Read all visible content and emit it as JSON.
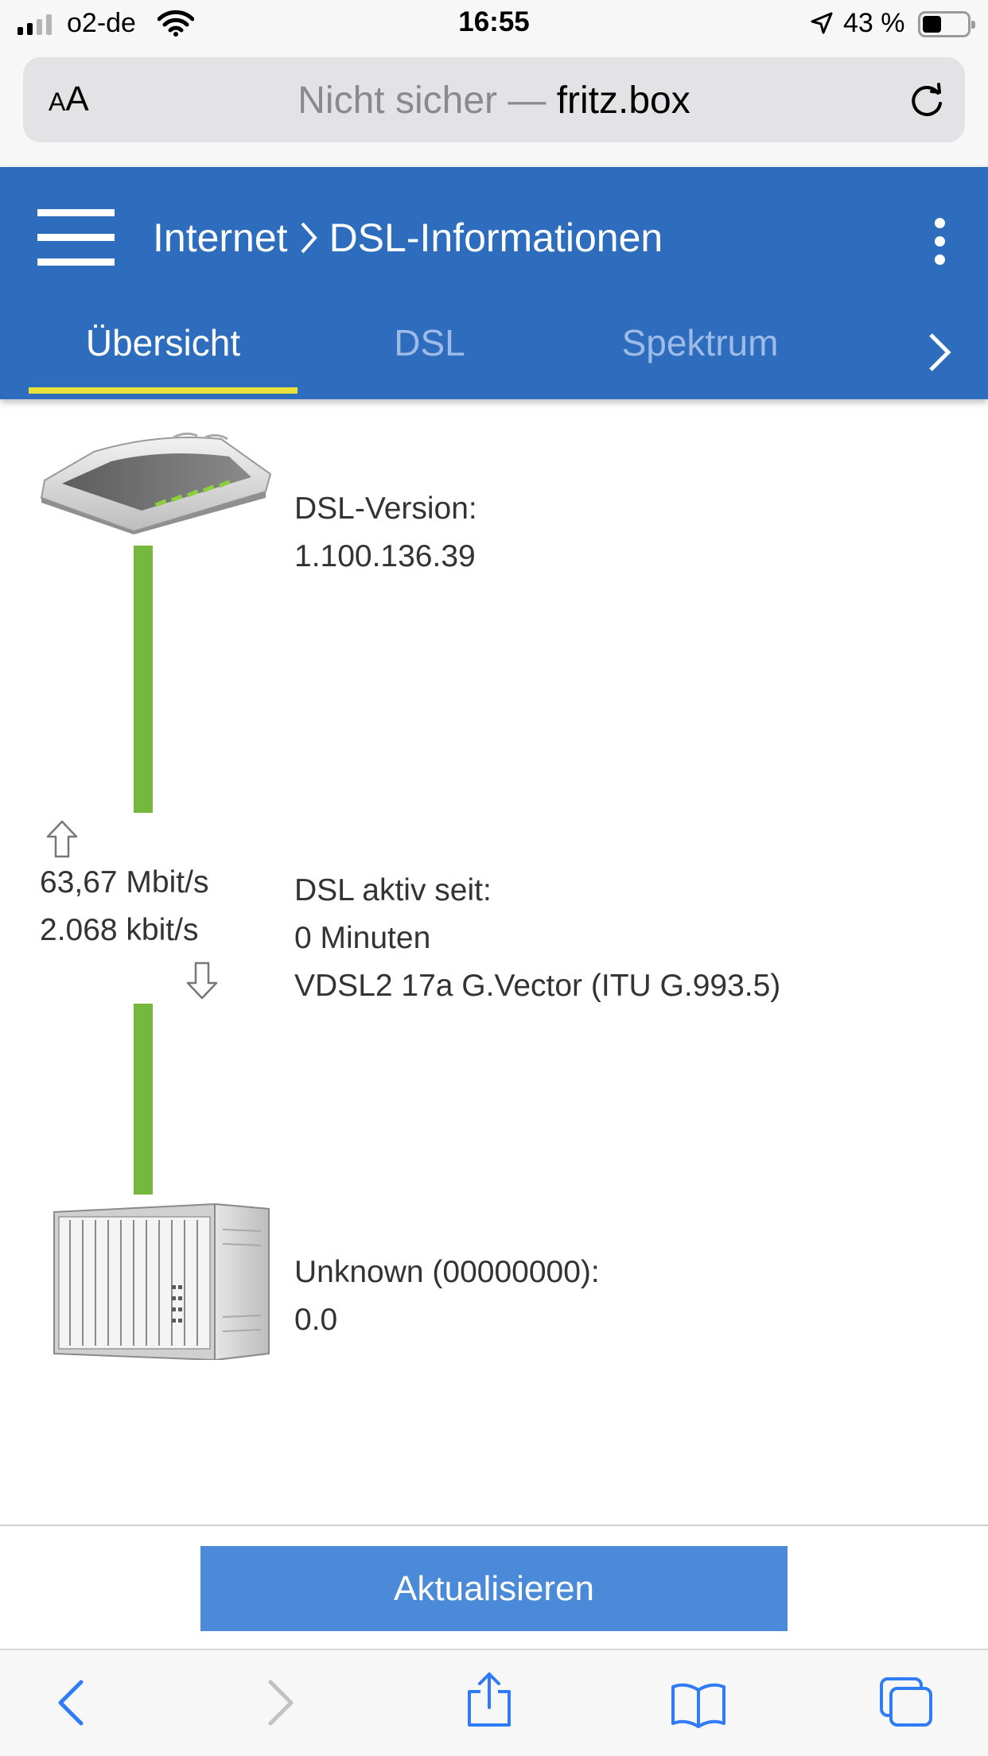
{
  "status_bar": {
    "carrier": "o2-de",
    "time": "16:55",
    "battery_percent": "43 %",
    "battery_level": 0.43,
    "signal_bars_active": 2,
    "signal_bars_total": 4
  },
  "browser": {
    "text_size_button": {
      "small": "A",
      "large": "A"
    },
    "security_label": "Nicht sicher —",
    "host": "fritz.box"
  },
  "header": {
    "breadcrumb": [
      "Internet",
      "DSL-Informationen"
    ],
    "tabs": [
      {
        "label": "Übersicht",
        "active": true
      },
      {
        "label": "DSL",
        "active": false
      },
      {
        "label": "Spektrum",
        "active": false
      }
    ]
  },
  "overview": {
    "router": {
      "label": "DSL-Version:",
      "value": "1.100.136.39"
    },
    "connection": {
      "upstream_rate": "63,67 Mbit/s",
      "downstream_rate": "2.068 kbit/s",
      "label": "DSL aktiv seit:",
      "duration": "0 Minuten",
      "standard": "VDSL2 17a G.Vector (ITU G.993.5)"
    },
    "dslam": {
      "label": "Unknown (00000000):",
      "value": "0.0"
    }
  },
  "actions": {
    "refresh_label": "Aktualisieren"
  },
  "colors": {
    "header_blue": "#2e6dbd",
    "tab_indicator": "#e8e23a",
    "link_line_green": "#76b83e",
    "button_blue": "#4a8ad8",
    "safari_blue": "#2f7cf6"
  }
}
